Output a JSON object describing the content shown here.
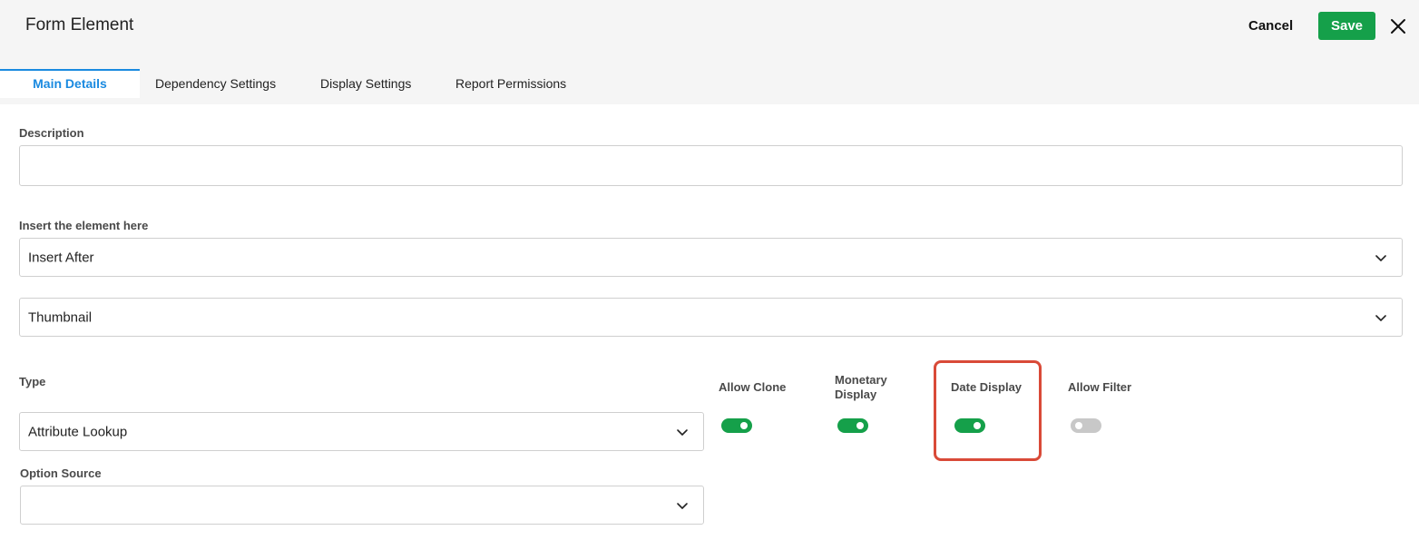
{
  "header": {
    "title": "Form Element",
    "cancel_label": "Cancel",
    "save_label": "Save"
  },
  "tabs": [
    {
      "label": "Main Details",
      "active": true
    },
    {
      "label": "Dependency Settings",
      "active": false
    },
    {
      "label": "Display Settings",
      "active": false
    },
    {
      "label": "Report Permissions",
      "active": false
    }
  ],
  "form": {
    "description": {
      "label": "Description",
      "value": ""
    },
    "insert": {
      "label": "Insert the element here",
      "position_value": "Insert After",
      "target_value": "Thumbnail"
    },
    "type": {
      "label": "Type",
      "value": "Attribute Lookup"
    },
    "option_source": {
      "label": "Option Source",
      "value": ""
    }
  },
  "toggles": [
    {
      "label": "Allow Clone",
      "on": true
    },
    {
      "label": "Monetary Display",
      "on": true
    },
    {
      "label": "Date Display",
      "on": true,
      "highlighted": true
    },
    {
      "label": "Allow Filter",
      "on": false
    }
  ],
  "colors": {
    "accent": "#1a8ae0",
    "save": "#15a04a",
    "toggle_on": "#15a04a",
    "toggle_off": "#c8c8c8",
    "highlight": "#d94a38"
  }
}
